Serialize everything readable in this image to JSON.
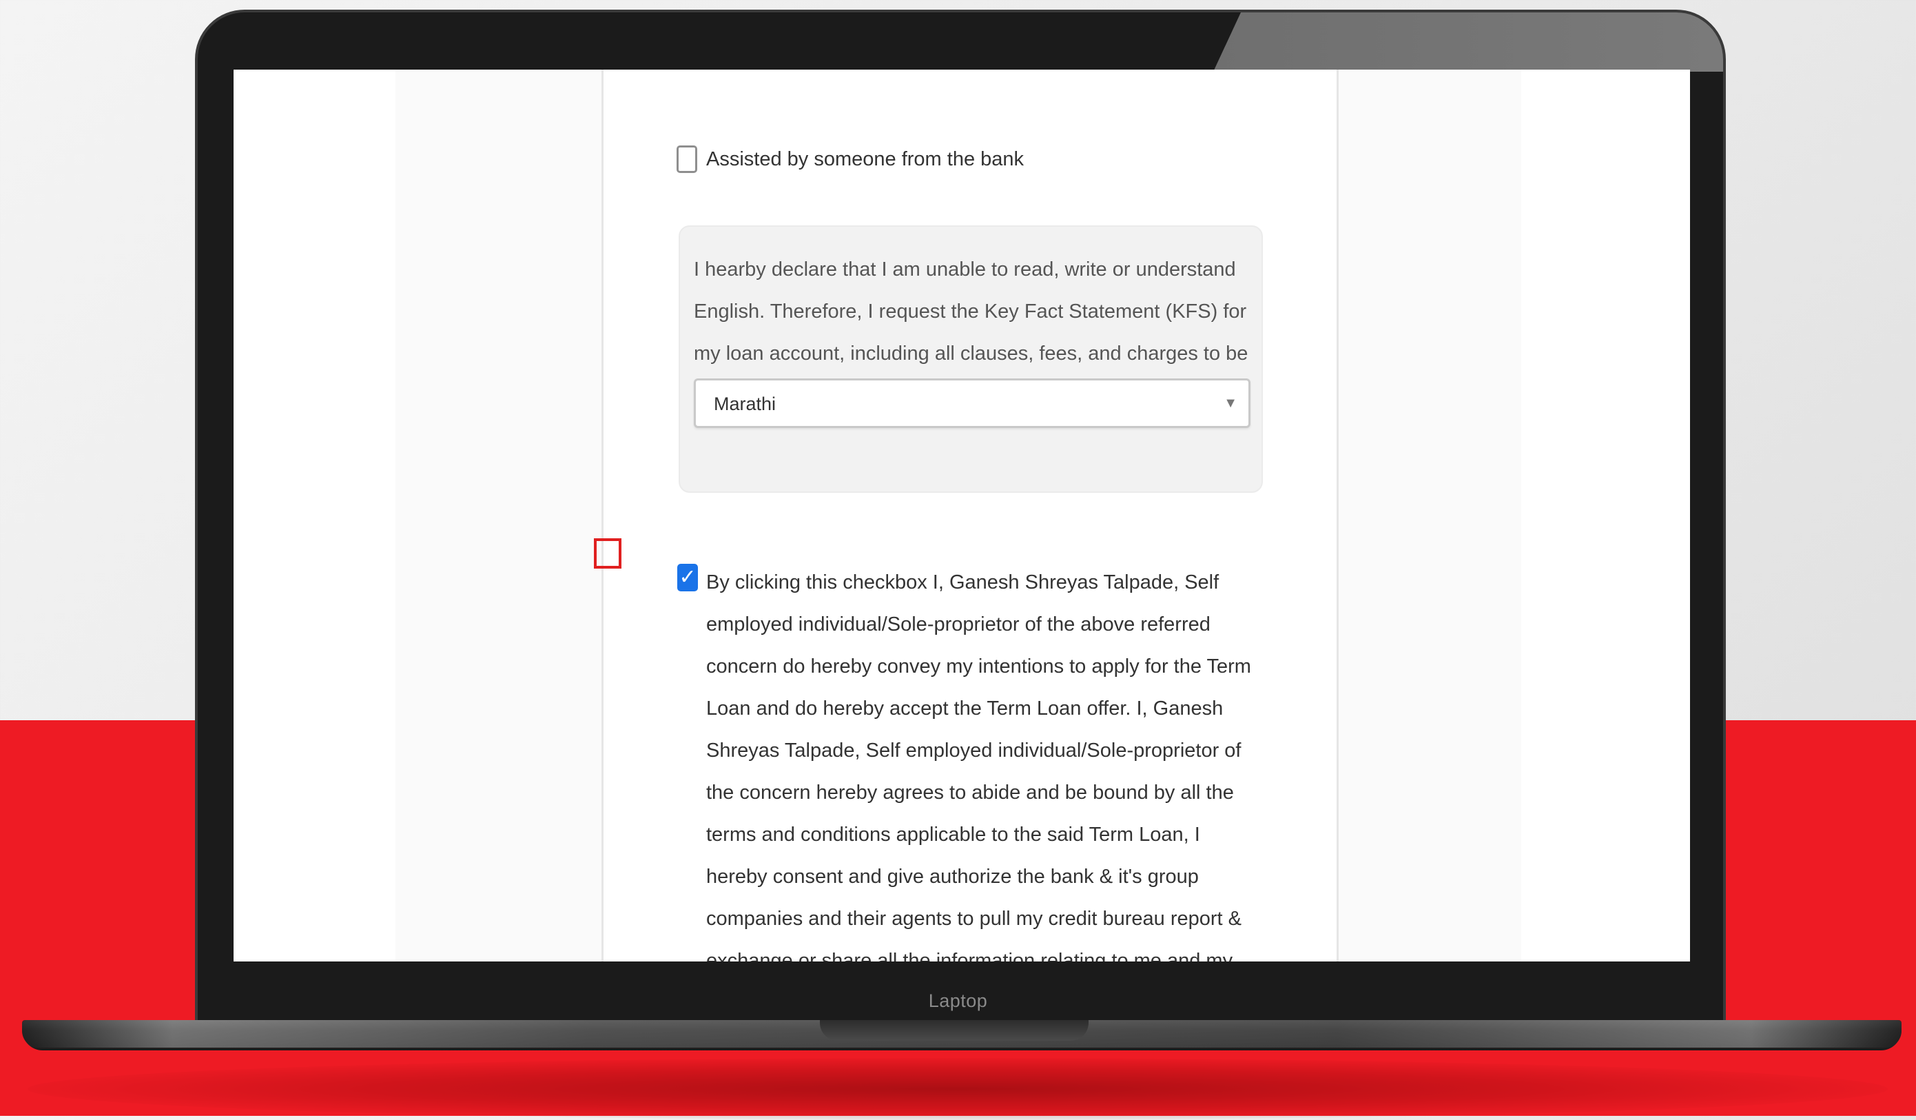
{
  "laptop": {
    "brand_label": "Laptop"
  },
  "form": {
    "assist_checkbox": {
      "label": "Assisted by someone from the bank",
      "checked": false
    },
    "declaration": {
      "text": "I hearby declare that I am unable to read, write or understand English. Therefore, I request the Key Fact Statement (KFS) for my loan account, including all clauses, fees, and charges to be provided in the following language",
      "language_select": {
        "selected": "Marathi"
      }
    },
    "consent_checkbox": {
      "checked": true,
      "text": "By clicking this checkbox I, Ganesh Shreyas Talpade, Self employed individual/Sole-proprietor of the above referred concern do hereby convey my intentions to apply for the Term Loan and do hereby accept the Term Loan offer. I, Ganesh Shreyas Talpade, Self employed individual/Sole-proprietor of the concern hereby agrees to abide and be bound by all the terms and conditions applicable to the said Term Loan, I hereby consent and give authorize the bank & it's group companies and their agents to pull my credit bureau report & exchange or share all the information relating to me and my repayment history with banks, financial institutions, credit bureaus, agencies, statutory bodies etc. as may be required or as they deem fit."
    }
  },
  "icons": {
    "select_arrow": "chevron-down-icon",
    "check": "checkmark-icon"
  },
  "colors": {
    "background_red": "#ee1b24",
    "checkbox_checked": "#1a73e8",
    "marker_red": "#e02020"
  }
}
